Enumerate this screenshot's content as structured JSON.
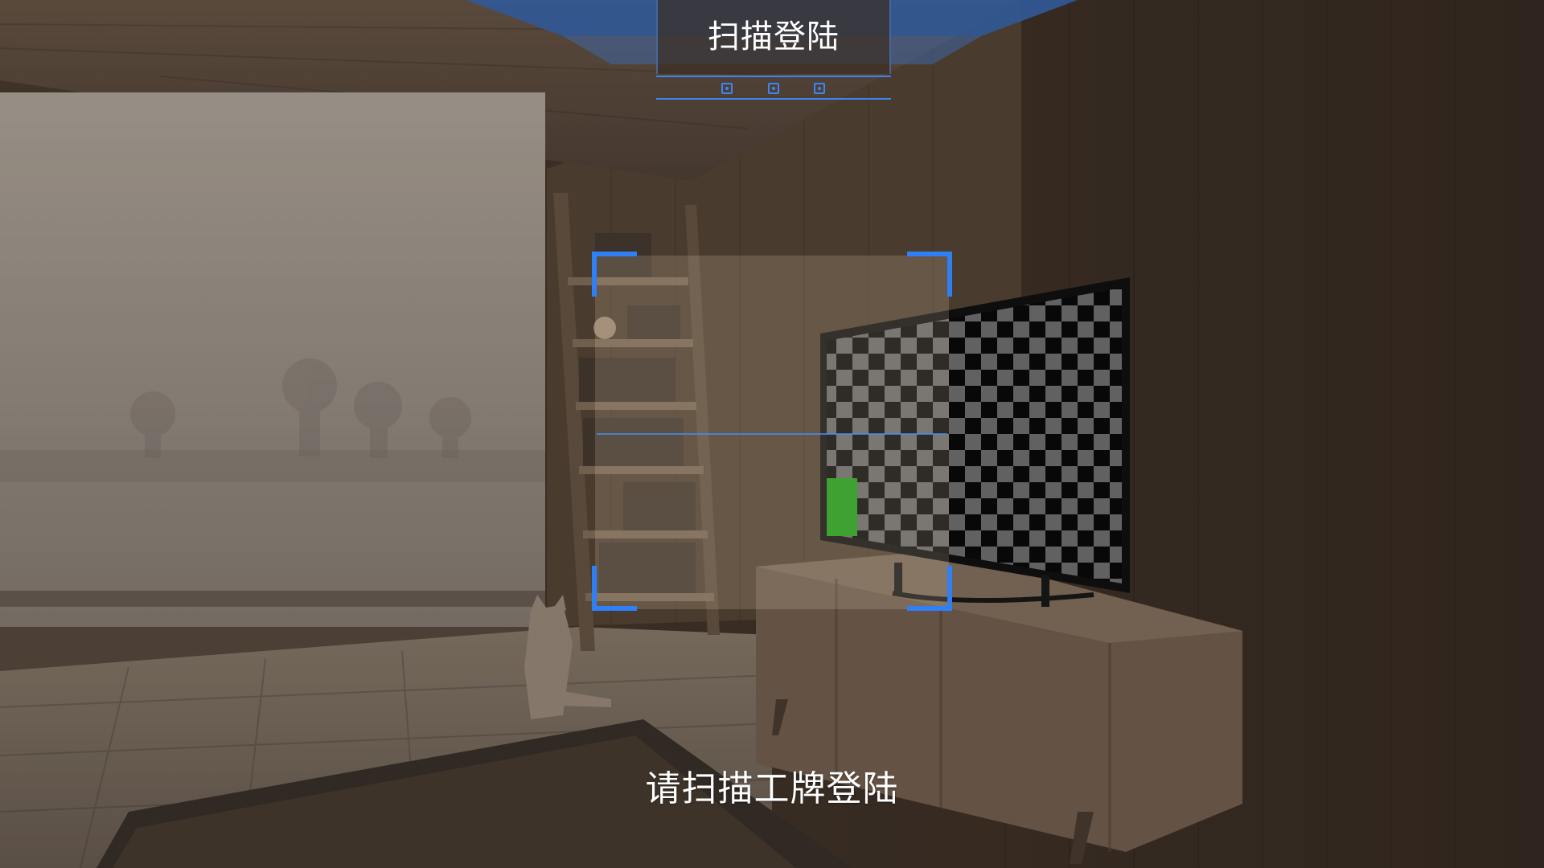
{
  "header": {
    "title": "扫描登陆",
    "indicator_count": 3
  },
  "scanner": {
    "prompt": "请扫描工牌登陆"
  },
  "colors": {
    "accent": "#2f7ff5",
    "title_text": "#ffffff",
    "scan_window_tint": "#f5e6cf",
    "marker_green": "#1fb51a"
  },
  "icons": {
    "scan_frame": "scan-frame-icon",
    "page_indicator": "dot-indicator-icon"
  }
}
